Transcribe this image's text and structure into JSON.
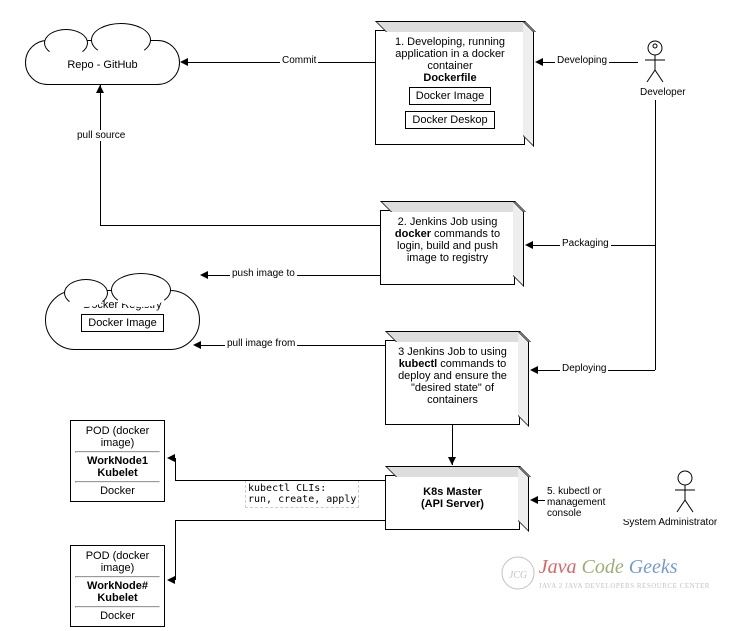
{
  "repo": {
    "title": "Repo - GitHub"
  },
  "dockerRegistry": {
    "title": "Docker Registry",
    "image": "Docker Image"
  },
  "step1": {
    "text": "1. Developing, running application in a docker container",
    "bold": "Dockerfile",
    "inner1": "Docker Image",
    "inner2": "Docker Deskop"
  },
  "step2": {
    "text1": "2. Jenkins Job using",
    "bold": "docker",
    "text2": "commands to login, build and push image to registry"
  },
  "step3": {
    "text1": "3 Jenkins Job to  using",
    "bold": "kubectl",
    "text2": "commands to deploy and ensure the \"desired state\" of containers"
  },
  "master": {
    "title": "K8s Master",
    "subtitle": "(API Server)"
  },
  "node1": {
    "pod": "POD (docker image)",
    "bold": "WorkNode1 Kubelet",
    "docker": "Docker"
  },
  "node2": {
    "pod": "POD (docker image)",
    "bold": "WorkNode# Kubelet",
    "docker": "Docker"
  },
  "actors": {
    "developer": "Developer",
    "sysadmin": "System Administrator"
  },
  "labels": {
    "commit": "Commit",
    "developing": "Developing",
    "pullSource": "pull source",
    "packaging": "Packaging",
    "pushImage": "push image to",
    "pullImage": "pull image from",
    "deploying": "Deploying",
    "kubectl": "5. kubectl or management console"
  },
  "note": {
    "line1": "kubectl CLIs:",
    "line2": "run, create, apply"
  },
  "watermark": {
    "brand": "Java Code Geeks",
    "tagline": "JAVA 2 JAVA DEVELOPERS RESOURCE CENTER"
  }
}
